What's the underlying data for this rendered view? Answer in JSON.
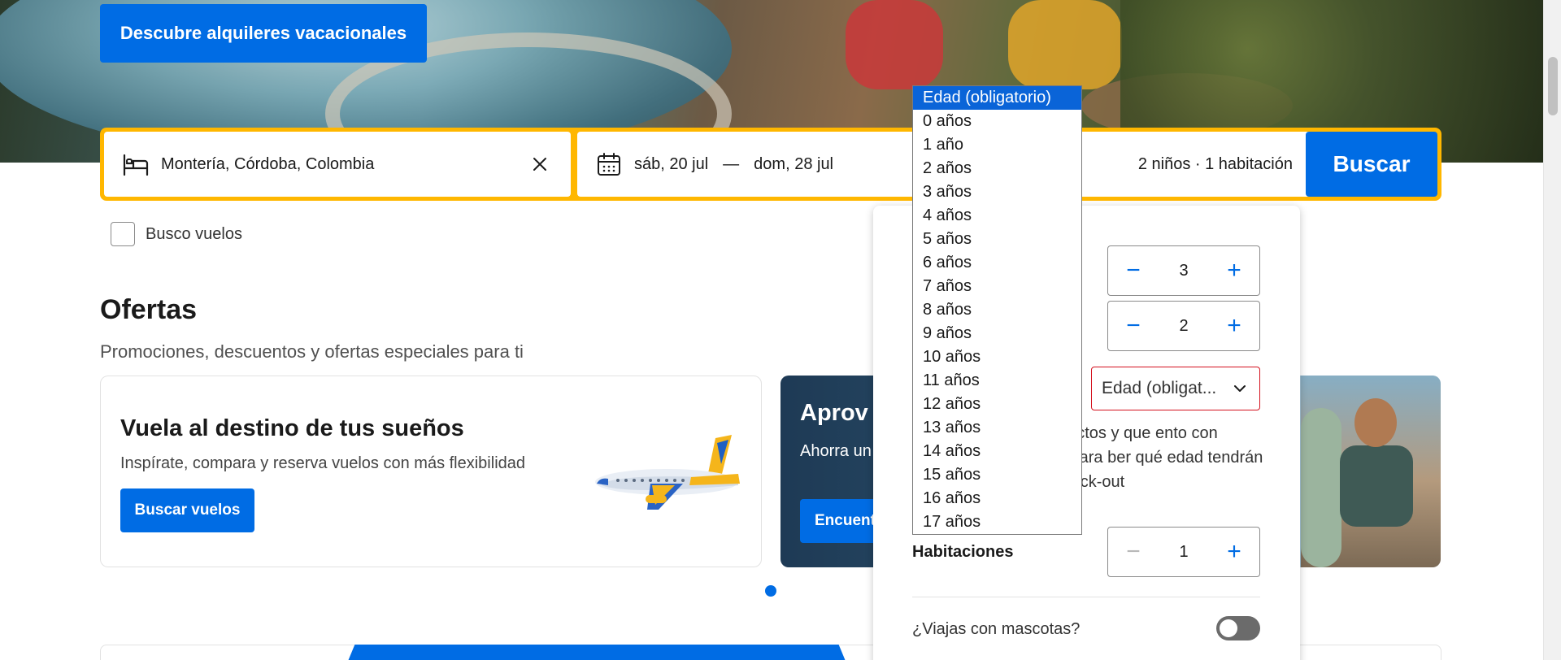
{
  "hero": {
    "button_label": "Descubre alquileres vacacionales"
  },
  "search": {
    "destination": "Montería, Córdoba, Colombia",
    "checkin": "sáb, 20 jul",
    "date_separator": "—",
    "checkout": "dom, 28 jul",
    "guests_summary": "2 niños · 1 habitación",
    "button_label": "Buscar"
  },
  "flights_checkbox_label": "Busco vuelos",
  "offers": {
    "title": "Ofertas",
    "subtitle": "Promociones, descuentos y ofertas especiales para ti",
    "card1": {
      "title": "Vuela al destino de tus sueños",
      "text": "Inspírate, compara y reserva vuelos con más flexibilidad",
      "button": "Buscar vuelos"
    },
    "card2": {
      "title": "Aprov",
      "text": "Ahorra un 01/10/202",
      "button": "Encuent"
    }
  },
  "occupancy": {
    "adults_value": "3",
    "children_value": "2",
    "age_select_value": "Edad (obligat...",
    "note": "tios correctos y que ento con espacio para ber qué edad tendrán to del check-out",
    "rooms_label": "Habitaciones",
    "rooms_value": "1",
    "pets_label": "¿Viajas con mascotas?",
    "pets_enabled": false
  },
  "age_dropdown": {
    "selected_index": 0,
    "options": [
      "Edad (obligatorio)",
      "0 años",
      "1 año",
      "2 años",
      "3 años",
      "4 años",
      "5 años",
      "6 años",
      "7 años",
      "8 años",
      "9 años",
      "10 años",
      "11 años",
      "12 años",
      "13 años",
      "14 años",
      "15 años",
      "16 años",
      "17 años"
    ]
  },
  "colors": {
    "primary": "#006ce4",
    "accent_yellow": "#ffb700",
    "error_red": "#d4111e"
  },
  "icons": [
    "bed-icon",
    "close-icon",
    "calendar-icon",
    "chevron-down-icon",
    "minus-icon",
    "plus-icon",
    "airplane-icon"
  ]
}
